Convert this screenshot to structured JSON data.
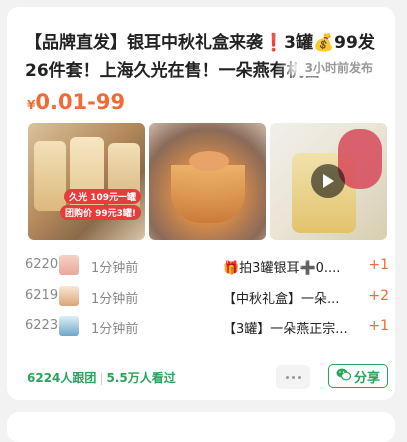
{
  "post": {
    "title": "【品牌直发】银耳中秋礼盒来袭❗3罐💰99发26件套！上海久光在售！一朵燕有机富",
    "time_ago": "3小时前发布",
    "price_symbol": "¥",
    "price_range": "0.01-99",
    "image1_tag_top": "久光 109元一罐",
    "image1_tag_bottom": "团购价 99元3罐!"
  },
  "orders": [
    {
      "num": "6220",
      "ago": "1分钟前",
      "desc": "🎁拍3罐银耳➕0....",
      "qty": "+1"
    },
    {
      "num": "6219",
      "ago": "1分钟前",
      "desc": "【中秋礼盒】一朵...",
      "qty": "+2"
    },
    {
      "num": "6223",
      "ago": "1分钟前",
      "desc": "【3罐】一朵燕正宗...",
      "qty": "+1"
    }
  ],
  "stats": {
    "followers": "6224人跟团",
    "views": "5.5万人看过"
  },
  "actions": {
    "share_label": "分享"
  },
  "colors": {
    "accent": "#f26a34",
    "green": "#2aa35c"
  }
}
